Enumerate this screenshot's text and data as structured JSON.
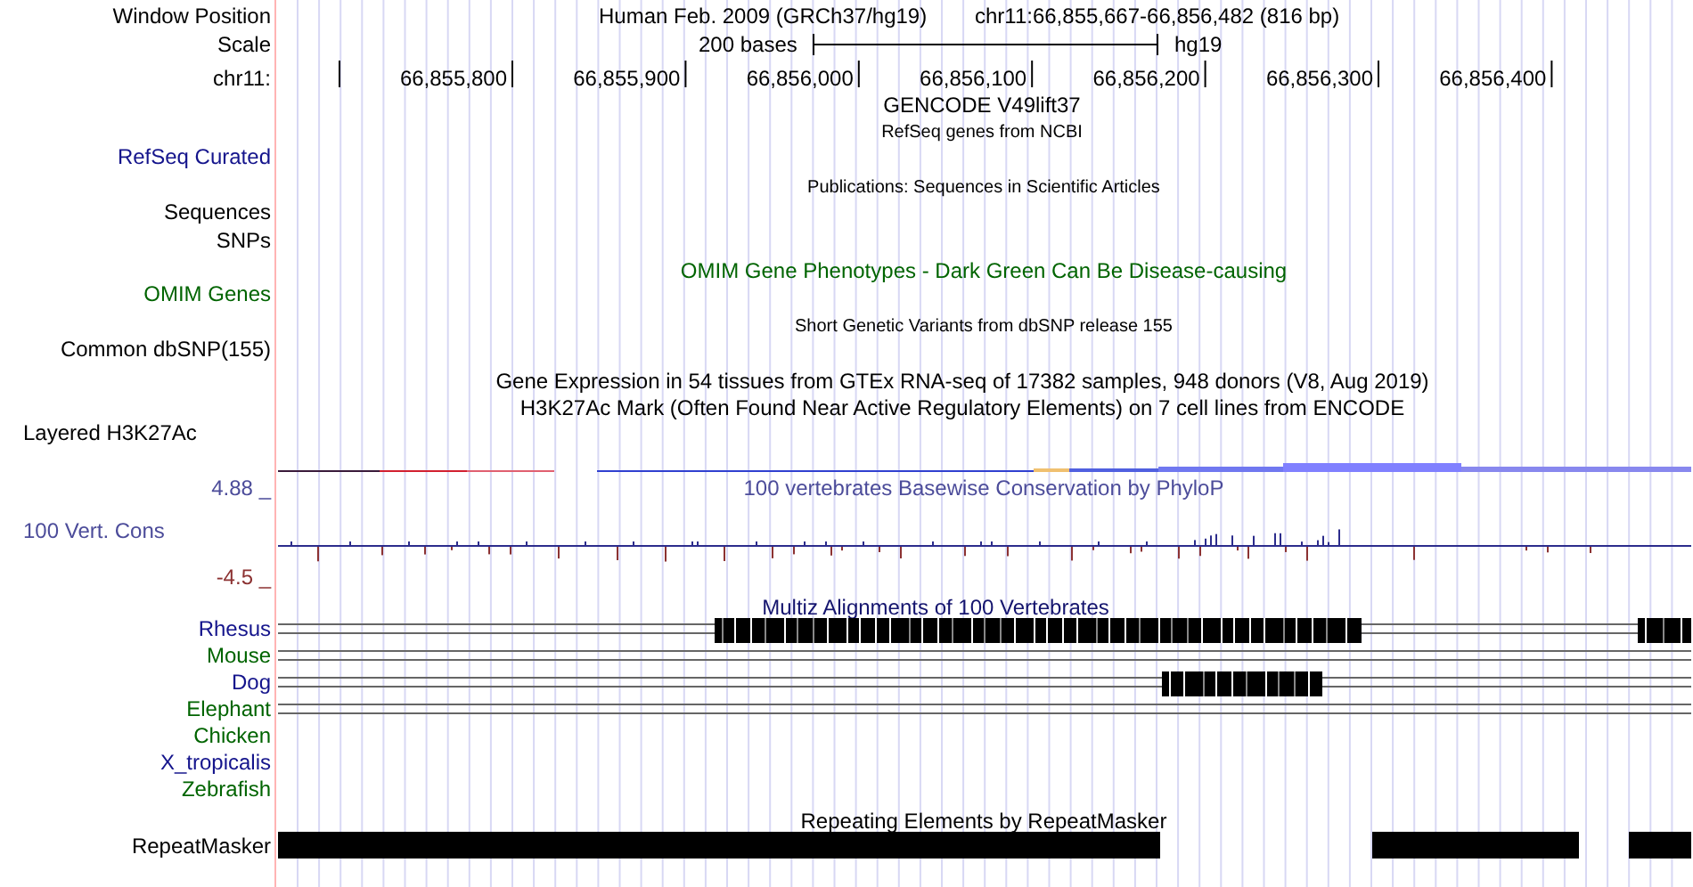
{
  "header": {
    "label": "Window Position",
    "assembly": "Human Feb. 2009 (GRCh37/hg19)",
    "position": "chr11:66,855,667-66,856,482 (816 bp)"
  },
  "scale": {
    "label": "Scale",
    "bar_label": "200 bases",
    "assembly": "hg19"
  },
  "ruler": {
    "label": "chr11:",
    "ticks": [
      "66,855,800",
      "66,855,900",
      "66,856,000",
      "66,856,100",
      "66,856,200",
      "66,856,300",
      "66,856,400"
    ]
  },
  "track_titles": [
    {
      "text": "GENCODE V49lift37",
      "kind": "main",
      "color": "#000000"
    },
    {
      "text": "RefSeq genes from NCBI",
      "kind": "note",
      "color": "#000000"
    },
    {
      "text": "Publications: Sequences in Scientific Articles",
      "kind": "note",
      "color": "#000000"
    },
    {
      "text": "OMIM Gene Phenotypes - Dark Green Can Be Disease-causing",
      "kind": "main",
      "color": "#006400"
    },
    {
      "text": "Short Genetic Variants from dbSNP release 155",
      "kind": "note",
      "color": "#000000"
    },
    {
      "text": "Gene Expression in 54 tissues from GTEx RNA-seq of 17382 samples, 948 donors (V8, Aug 2019)",
      "kind": "main",
      "color": "#000000"
    },
    {
      "text": "H3K27Ac Mark (Often Found Near Active Regulatory Elements) on 7 cell lines from ENCODE",
      "kind": "main",
      "color": "#000000"
    },
    {
      "text": "100 vertebrates Basewise Conservation by PhyloP",
      "kind": "main",
      "color": "#4c4c9a"
    },
    {
      "text": "Multiz Alignments of 100 Vertebrates",
      "kind": "main",
      "color": "#14146e"
    },
    {
      "text": "Repeating Elements by RepeatMasker",
      "kind": "main",
      "color": "#000000"
    }
  ],
  "track_labels": [
    {
      "text": "RefSeq Curated",
      "color": "#14148c"
    },
    {
      "text": "Sequences",
      "color": "#000000"
    },
    {
      "text": "SNPs",
      "color": "#000000"
    },
    {
      "text": "OMIM Genes",
      "color": "#006400"
    },
    {
      "text": "Common dbSNP(155)",
      "color": "#000000"
    },
    {
      "text": "Layered H3K27Ac",
      "color": "#000000"
    },
    {
      "text": "100 Vert. Cons",
      "color": "#4c4c9a"
    },
    {
      "text": "RepeatMasker",
      "color": "#000000"
    }
  ],
  "axis_labels": [
    {
      "text": "4.88 _",
      "color": "#4c4c9a"
    },
    {
      "text": "-4.5 _",
      "color": "#8c3232"
    }
  ],
  "species": [
    {
      "text": "Rhesus",
      "color": "#14148c"
    },
    {
      "text": "Mouse",
      "color": "#006400"
    },
    {
      "text": "Dog",
      "color": "#14148c"
    },
    {
      "text": "Elephant",
      "color": "#006400"
    },
    {
      "text": "Chicken",
      "color": "#006400"
    },
    {
      "text": "X_tropicalis",
      "color": "#14148c"
    },
    {
      "text": "Zebrafish",
      "color": "#006400"
    }
  ]
}
